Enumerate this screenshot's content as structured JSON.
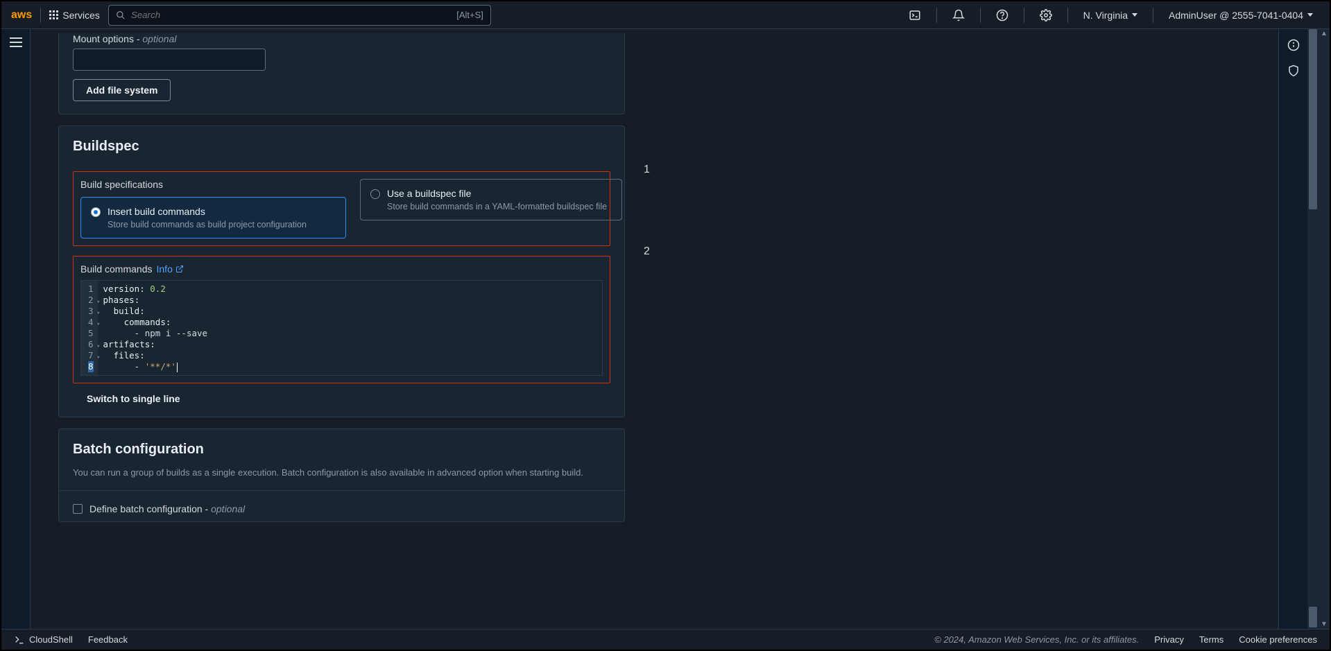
{
  "nav": {
    "services_label": "Services",
    "search_placeholder": "Search",
    "search_hint": "[Alt+S]",
    "region": "N. Virginia",
    "account": "AdminUser @ 2555-7041-0404"
  },
  "mount": {
    "label": "Mount options - ",
    "label_opt": "optional",
    "value": "",
    "add_btn": "Add file system"
  },
  "buildspec": {
    "heading": "Buildspec",
    "spec_label": "Build specifications",
    "tile1_title": "Insert build commands",
    "tile1_desc": "Store build commands as build project configuration",
    "tile2_title": "Use a buildspec file",
    "tile2_desc": "Store build commands in a YAML-formatted buildspec file",
    "editor_label": "Build commands",
    "info_link": "Info",
    "code_lines": {
      "l1a": "version",
      "l1b": ": ",
      "l1c": "0.2",
      "l2a": "phases",
      "l2b": ":",
      "l3a": "  build",
      "l3b": ":",
      "l4a": "    commands",
      "l4b": ":",
      "l5a": "      - ",
      "l5b": "npm i --save",
      "l6a": "artifacts",
      "l6b": ":",
      "l7a": "  files",
      "l7b": ":",
      "l8a": "      - ",
      "l8b": "'**/*'"
    },
    "switch_line": "Switch to single line"
  },
  "batch": {
    "heading": "Batch configuration",
    "desc": "You can run a group of builds as a single execution. Batch configuration is also available in advanced option when starting build.",
    "checkbox_label": "Define batch configuration - ",
    "checkbox_opt": "optional"
  },
  "markers": {
    "m1": "1",
    "m2": "2"
  },
  "footer": {
    "cloudshell": "CloudShell",
    "feedback": "Feedback",
    "copyright": "© 2024, Amazon Web Services, Inc. or its affiliates.",
    "privacy": "Privacy",
    "terms": "Terms",
    "cookies": "Cookie preferences"
  }
}
